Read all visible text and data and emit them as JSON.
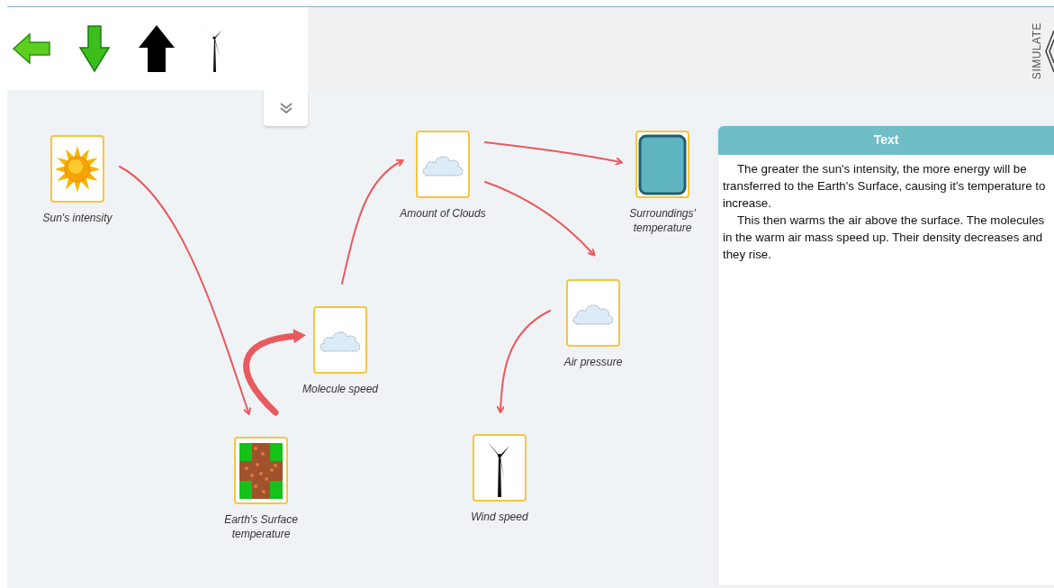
{
  "toolbar": {
    "brand": "SIMULATE"
  },
  "nodes": [
    {
      "label": "Sun's intensity",
      "kind": "sun"
    },
    {
      "label": "Earth's Surface temperature",
      "kind": "ground"
    },
    {
      "label": "Molecule speed",
      "kind": "cloud"
    },
    {
      "label": "Amount of Clouds",
      "kind": "cloud"
    },
    {
      "label": "Surroundings' temperature",
      "kind": "square"
    },
    {
      "label": "Air pressure",
      "kind": "cloud"
    },
    {
      "label": "Wind speed",
      "kind": "turbine"
    }
  ],
  "text_panel": {
    "title": "Text",
    "paragraphs": [
      "The greater the sun's intensity, the more energy will be transferred to the Earth's Surface, causing it's temperature to increase.",
      "This then warms the air above the surface. The molecules in the warm air mass speed up. Their density decreases and they rise."
    ]
  }
}
